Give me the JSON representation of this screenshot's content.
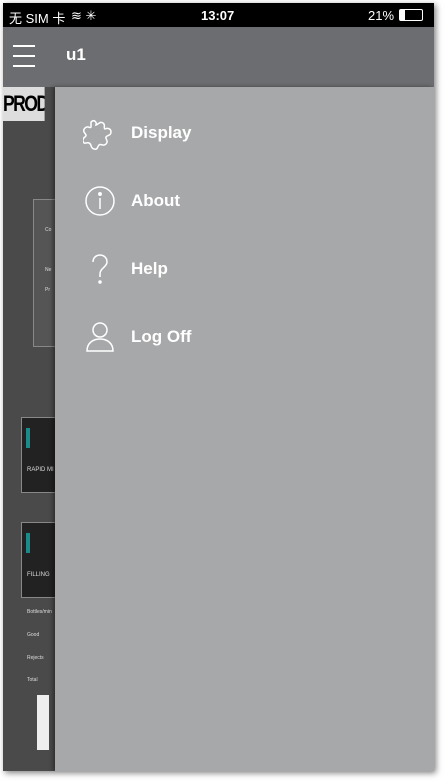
{
  "status": {
    "carrier": "无 SIM 卡",
    "time": "13:07",
    "battery": "21%"
  },
  "nav": {
    "title": "u1"
  },
  "background": {
    "header": "PRODUC",
    "panel1_label": "RAPID MI",
    "panel2_label": "FILLING",
    "small_labels": [
      "Co",
      "Ne",
      "Pr"
    ],
    "stats": [
      "Bottles/min",
      "Good",
      "Rejects",
      "Total"
    ]
  },
  "menu": [
    {
      "label": "Display",
      "icon": "puzzle-icon"
    },
    {
      "label": "About",
      "icon": "info-icon"
    },
    {
      "label": "Help",
      "icon": "question-icon"
    },
    {
      "label": "Log Off",
      "icon": "user-icon"
    }
  ]
}
